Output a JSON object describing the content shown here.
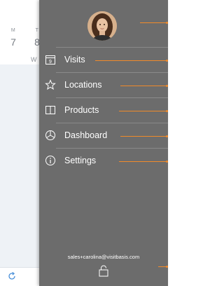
{
  "calendar": {
    "days": [
      {
        "dow": "M",
        "num": "7"
      },
      {
        "dow": "T",
        "num": "8"
      }
    ],
    "week_fragment": "W"
  },
  "drawer": {
    "user_email": "sales+carolina@visitbasis.com",
    "menu": [
      {
        "id": "visits",
        "label": "Visits",
        "icon": "calendar-icon"
      },
      {
        "id": "locations",
        "label": "Locations",
        "icon": "star-icon"
      },
      {
        "id": "products",
        "label": "Products",
        "icon": "book-icon"
      },
      {
        "id": "dashboard",
        "label": "Dashboard",
        "icon": "pie-chart-icon"
      },
      {
        "id": "settings",
        "label": "Settings",
        "icon": "info-icon"
      }
    ],
    "visits_icon_text": "9"
  },
  "colors": {
    "drawer_bg": "#6c6c6c",
    "accent_line": "#f08a2a",
    "refresh": "#4a90d9"
  }
}
